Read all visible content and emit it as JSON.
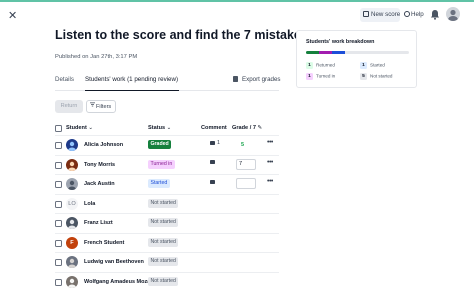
{
  "header": {
    "new_score_label": "New score",
    "help_label": "Help"
  },
  "assignment": {
    "title": "Listen to the score and find the 7 mistakes",
    "published": "Published on Jan 27th, 3:17 PM"
  },
  "tabs": [
    {
      "label": "Details"
    },
    {
      "label": "Students' work (1 pending review)"
    }
  ],
  "export_label": "Export grades",
  "toolbar": {
    "return_label": "Return",
    "filters_label": "Filters"
  },
  "table": {
    "columns": {
      "student": "Student",
      "status": "Status",
      "comment": "Comment",
      "grade": "Grade / 7"
    },
    "rows": [
      {
        "name": "Alicia Johnson",
        "status": "Graded",
        "comment": "1",
        "grade": "5"
      },
      {
        "name": "Tony Morris",
        "status": "Turned in",
        "comment": "",
        "grade": "7"
      },
      {
        "name": "Jack Austin",
        "status": "Started",
        "comment": "",
        "grade": ""
      },
      {
        "name": "Lola",
        "initials": "LO",
        "status": "Not started"
      },
      {
        "name": "Franz Liszt",
        "status": "Not started"
      },
      {
        "name": "French Student",
        "initials": "F",
        "status": "Not started"
      },
      {
        "name": "Ludwig van Beethoven",
        "status": "Not started"
      },
      {
        "name": "Wolfgang Amadeus Mozart",
        "status": "Not started"
      }
    ]
  },
  "breakdown": {
    "title": "Students' work breakdown",
    "items": [
      {
        "count": "1",
        "label": "Returned"
      },
      {
        "count": "1",
        "label": "Started"
      },
      {
        "count": "1",
        "label": "Turned in"
      },
      {
        "count": "5",
        "label": "Not started"
      }
    ]
  },
  "colors": {
    "graded": "#15803d",
    "turned_in": "#f5d0fe",
    "started": "#dbeafe",
    "not_started": "#e5e7eb",
    "accent": "#60c3a6"
  }
}
